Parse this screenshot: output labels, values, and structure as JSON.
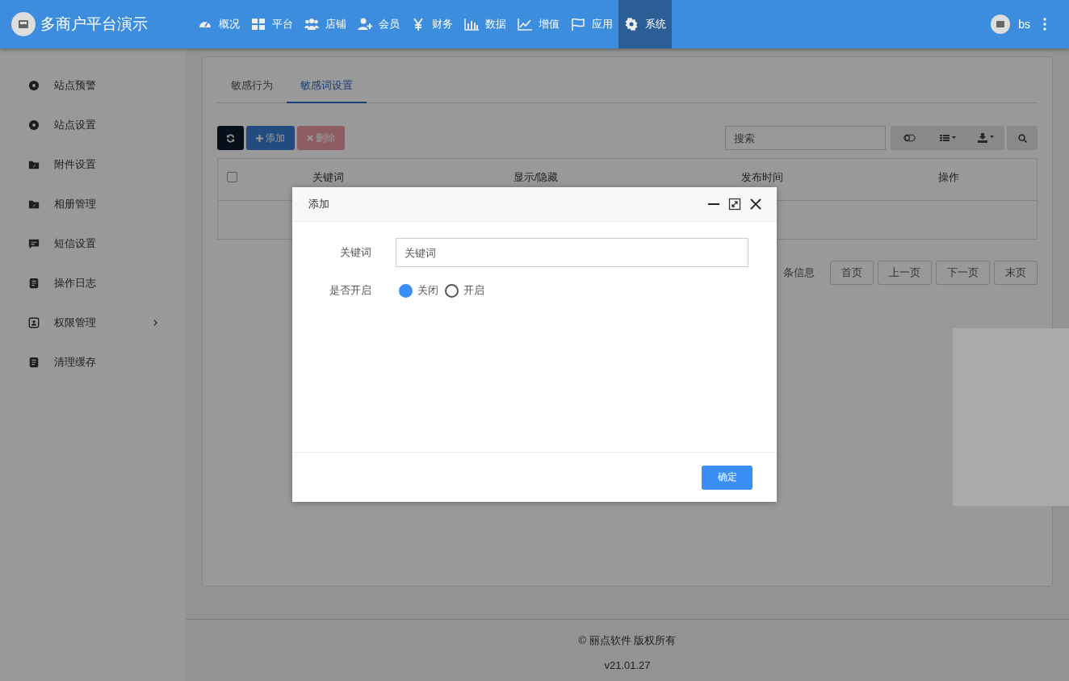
{
  "brand": {
    "title": "多商户平台演示"
  },
  "nav": [
    {
      "label": "概况",
      "selected": false
    },
    {
      "label": "平台",
      "selected": false
    },
    {
      "label": "店铺",
      "selected": false
    },
    {
      "label": "会员",
      "selected": false
    },
    {
      "label": "财务",
      "selected": false
    },
    {
      "label": "数据",
      "selected": false
    },
    {
      "label": "增值",
      "selected": false
    },
    {
      "label": "应用",
      "selected": false
    },
    {
      "label": "系统",
      "selected": true
    }
  ],
  "user": {
    "name": "bs"
  },
  "sidebar": {
    "items": [
      {
        "label": "站点预警",
        "has_submenu": false
      },
      {
        "label": "站点设置",
        "has_submenu": false
      },
      {
        "label": "附件设置",
        "has_submenu": false
      },
      {
        "label": "相册管理",
        "has_submenu": false
      },
      {
        "label": "短信设置",
        "has_submenu": false
      },
      {
        "label": "操作日志",
        "has_submenu": false
      },
      {
        "label": "权限管理",
        "has_submenu": true
      },
      {
        "label": "清理缓存",
        "has_submenu": false
      }
    ]
  },
  "tabs": [
    {
      "label": "敏感行为",
      "selected": false
    },
    {
      "label": "敏感词设置",
      "selected": true
    }
  ],
  "toolbar": {
    "buttons": [
      {
        "kind": "refresh",
        "disabled": false
      },
      {
        "kind": "add",
        "label": "添加",
        "disabled": false
      },
      {
        "kind": "delete",
        "label": "删除",
        "disabled": true
      }
    ],
    "search": {
      "placeholder": "搜索"
    }
  },
  "table": {
    "select_all": {
      "checked": false
    },
    "columns": [
      "关键词",
      "显示/隐藏",
      "发布时间",
      "操作"
    ]
  },
  "pagination": {
    "info": "条信息",
    "buttons": [
      "首页",
      "上一页",
      "下一页",
      "末页"
    ]
  },
  "dialog": {
    "title": "添加",
    "keyword": {
      "label": "关键词",
      "placeholder": "关键词"
    },
    "enabled": {
      "label": "是否开启",
      "options": [
        {
          "label": "关闭",
          "selected": true
        },
        {
          "label": "开启",
          "selected": false
        }
      ]
    },
    "confirm": "确定"
  },
  "footer": {
    "copyright": "© 丽点软件 版权所有",
    "version": "v21.01.27"
  }
}
